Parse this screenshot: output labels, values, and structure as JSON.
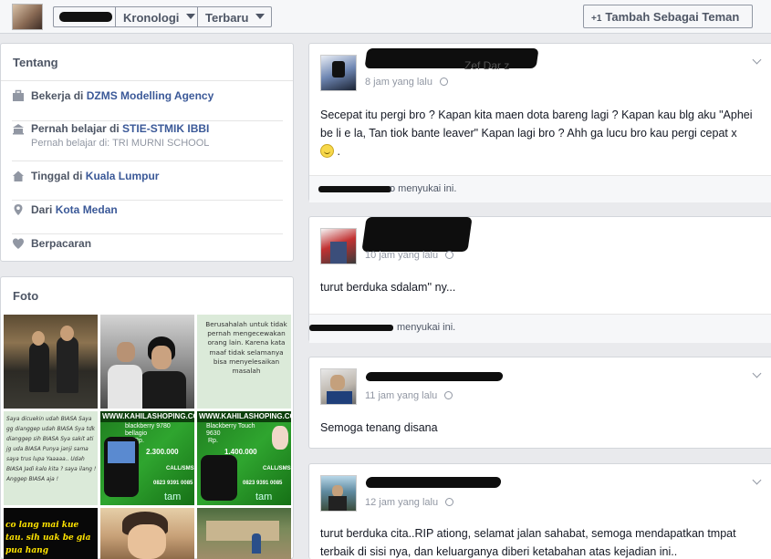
{
  "header": {
    "timeline_label": "Kronologi",
    "latest_label": "Terbaru",
    "add_friend_label": "Tambah Sebagai Teman",
    "add_friend_glyph": "+1"
  },
  "about": {
    "title": "Tentang",
    "work_prefix": "Bekerja di ",
    "work_place": "DZMS Modelling Agency",
    "study_prefix": "Pernah belajar di ",
    "study_place": "STIE-STMIK IBBI",
    "study_sub": "Pernah belajar di: TRI MURNI SCHOOL",
    "live_prefix": "Tinggal di ",
    "live_place": "Kuala Lumpur",
    "from_prefix": "Dari ",
    "from_place": "Kota Medan",
    "relationship": "Berpacaran"
  },
  "photos": {
    "title": "Foto",
    "quote_text": "Berusahalah untuk tidak pernah mengecewakan orang lain. Karena kata maaf tidak selamanya bisa menyelesaikan masalah",
    "biasa_text": "Saya dicuekin udah BIASA Saya gg dianggep udah BIASA Sya tdk dianggep sih BIASA Sya sakit ati jg uda BIASA Punya janji sama saya trus lupa Yaaaaa.. Udah BIASA Jadi kalo kita ? saya ilang ! Anggep BIASA aja !",
    "shop_url": "WWW.KAHILASHOPING.COM",
    "shop_url_2": "WWW.KAHILASHOPING.COM",
    "bb_model_1": "blackberry 9780 bellagio",
    "bb_model_2": "Blackberry Touch 9630",
    "bb_price_1": "2.300.000",
    "bb_price_2": "1.400.000",
    "rp": "Rp.",
    "call_sms": "CALL/SMS",
    "phone": "0823 9391 0085",
    "tam": "tam",
    "bottom_quote": "co lang mai kue tau. sih uak be gia pua hang"
  },
  "posts": [
    {
      "time": "8 jam yang lalu",
      "name_fragment": "Zef Dar z",
      "body": "Secepat itu pergi bro ? Kapan kita maen dota bareng lagi ? Kapan kau blg aku \"Aphei be li e la, Tan tiok bante leaver\" Kapan lagi bro ? Ahh ga lucu bro kau pergi cepat x",
      "body_end": " .",
      "likes_suffix": "o menyukai ini."
    },
    {
      "time": "10 jam yang lalu",
      "body": "turut berduka sdalam'' ny...",
      "likes_suffix": "menyukai ini."
    },
    {
      "time": "11 jam yang lalu",
      "body": "Semoga tenang disana"
    },
    {
      "time": "12 jam yang lalu",
      "body": "turut berduka cita..RIP ationg, selamat jalan sahabat, semoga mendapatkan tmpat terbaik di sisi nya, dan keluarganya diberi ketabahan atas kejadian ini.."
    }
  ]
}
